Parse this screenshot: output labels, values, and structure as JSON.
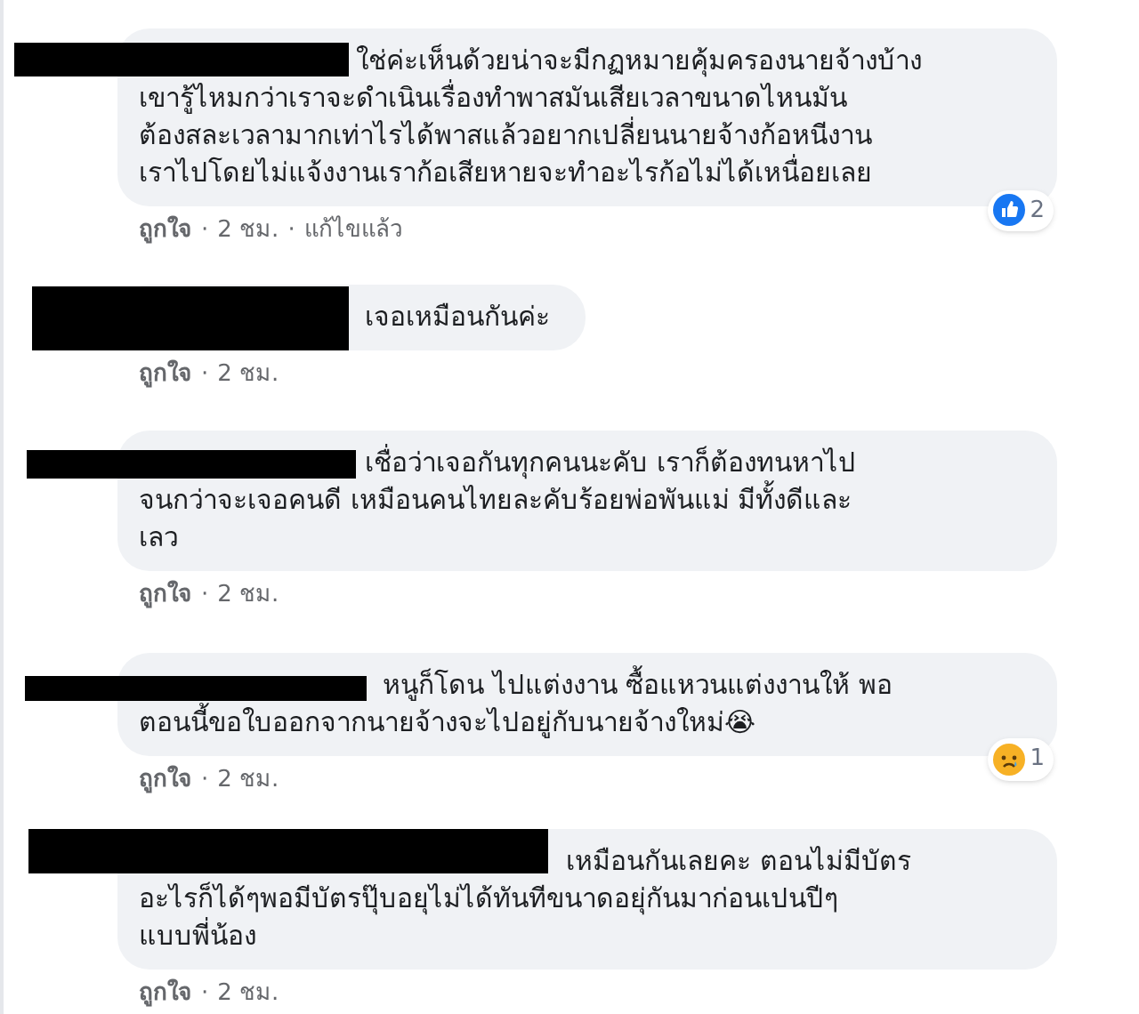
{
  "comments": [
    {
      "lines": [
        "ใช่ค่ะเห็นด้วยน่าจะมีกฏหมายคุ้มครองนายจ้างบ้าง",
        "เขารู้ไหมกว่าเราจะดำเนินเรื่องทำพาสมันเสียเวลาขนาดไหนมัน",
        "ต้องสละเวลามากเท่าไรได้พาสแล้วอยากเปลี่ยนนายจ้างก้อหนีงาน",
        "เราไปโดยไม่แจ้งงานเราก้อเสียหายจะทำอะไรก้อไม่ได้เหนื่อยเลย"
      ],
      "reaction": {
        "kind": "like",
        "count": "2"
      },
      "meta": [
        "ถูกใจ",
        "·",
        "2 ชม.",
        "·",
        "แก้ไขแล้ว"
      ]
    },
    {
      "lines": [
        "เจอเหมือนกันค่ะ"
      ],
      "meta": [
        "ถูกใจ",
        "·",
        "2 ชม."
      ]
    },
    {
      "lines": [
        "เชื่อว่าเจอกันทุกคนนะคับ เราก็ต้องทนหาไป",
        "จนกว่าจะเจอคนดี เหมือนคนไทยละคับร้อยพ่อพันแม่ มีทั้งดีและ",
        "เลว"
      ],
      "meta": [
        "ถูกใจ",
        "·",
        "2 ชม."
      ]
    },
    {
      "lines": [
        "หนูก็โดน ไปแต่งงาน ซื้อแหวนแต่งงานให้ พอ",
        "ตอนนี้ขอใบออกจากนายจ้างจะไปอยู่กับนายจ้างใหม่😭"
      ],
      "reaction": {
        "kind": "sad",
        "count": "1"
      },
      "meta": [
        "ถูกใจ",
        "·",
        "2 ชม."
      ]
    },
    {
      "lines": [
        "เหมือนกันเลยคะ ตอนไม่มีบัตร",
        "อะไรก็ได้ๆพอมีบัตรปุ๊บอยุไม่ได้ทันทีขนาดอยุ่กันมาก่อนเปนปีๆ",
        "แบบพี่น้อง"
      ],
      "meta": [
        "ถูกใจ",
        "·",
        "2 ชม."
      ]
    }
  ]
}
